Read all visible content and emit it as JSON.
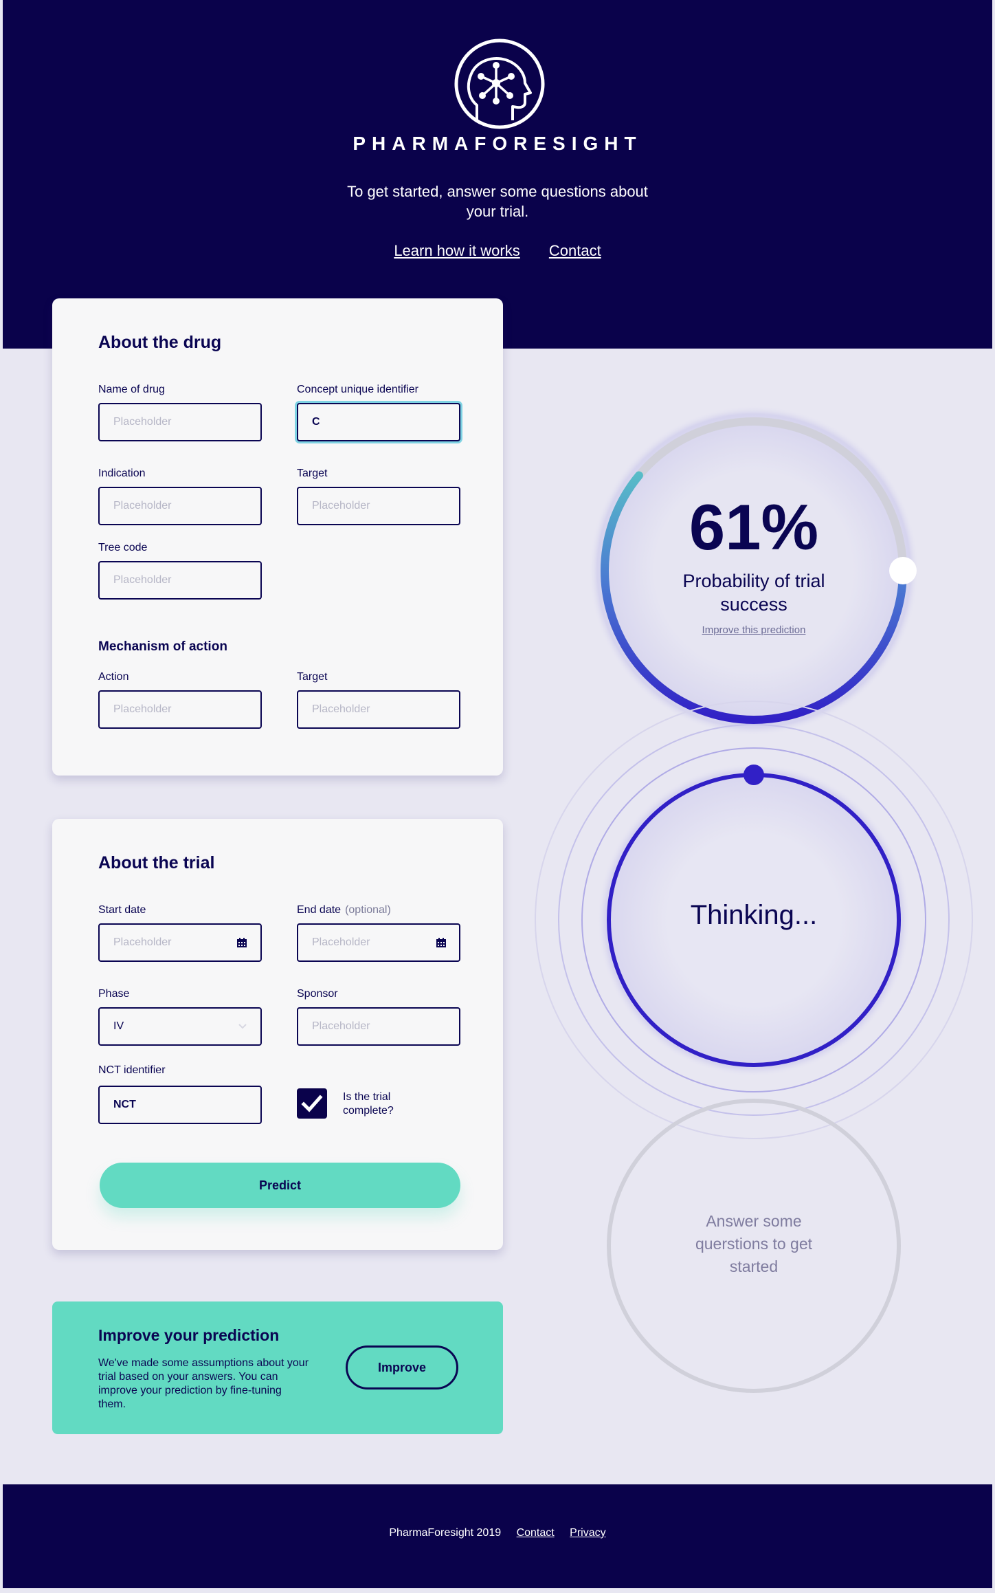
{
  "brand": {
    "name": "PHARMAFORESIGHT"
  },
  "header": {
    "tagline": "To get started, answer some questions about your trial.",
    "links": {
      "learn": "Learn how it works",
      "contact": "Contact"
    }
  },
  "drug_card": {
    "title": "About the drug",
    "fields": {
      "name_of_drug": {
        "label": "Name of drug",
        "placeholder": "Placeholder",
        "value": ""
      },
      "cui": {
        "label": "Concept unique identifier",
        "placeholder": "Placeholder",
        "value": "C"
      },
      "indication": {
        "label": "Indication",
        "placeholder": "Placeholder",
        "value": ""
      },
      "target": {
        "label": "Target",
        "placeholder": "Placeholder",
        "value": ""
      },
      "tree_code": {
        "label": "Tree code",
        "placeholder": "Placeholder",
        "value": ""
      }
    },
    "moa": {
      "title": "Mechanism of action",
      "action": {
        "label": "Action",
        "placeholder": "Placeholder",
        "value": ""
      },
      "target": {
        "label": "Target",
        "placeholder": "Placeholder",
        "value": ""
      }
    }
  },
  "trial_card": {
    "title": "About the trial",
    "start_date": {
      "label": "Start date",
      "placeholder": "Placeholder",
      "value": ""
    },
    "end_date": {
      "label": "End date",
      "optional": "(optional)",
      "placeholder": "Placeholder",
      "value": ""
    },
    "phase": {
      "label": "Phase",
      "value": "IV"
    },
    "sponsor": {
      "label": "Sponsor",
      "placeholder": "Placeholder",
      "value": ""
    },
    "nct": {
      "label": "NCT identifier",
      "value": "NCT"
    },
    "complete": {
      "label": "Is the trial complete?",
      "checked": true
    },
    "predict_button": "Predict"
  },
  "improve_card": {
    "title": "Improve your prediction",
    "text": "We've made some assumptions about your trial based on your answers. You can improve your prediction by fine-tuning them.",
    "button": "Improve"
  },
  "results": {
    "success": {
      "percent_label": "61%",
      "probability": 0.61,
      "label": "Probability of trial success",
      "improve_link": "Improve this prediction"
    },
    "thinking": {
      "label": "Thinking..."
    },
    "empty": {
      "label": "Answer some querstions to get started"
    }
  },
  "colors": {
    "navy": "#0a024b",
    "mint": "#62dac2",
    "indigo": "#3120c6",
    "background": "#e8e7f2"
  },
  "footer": {
    "copyright": "PharmaForesight 2019",
    "contact": "Contact",
    "privacy": "Privacy"
  }
}
